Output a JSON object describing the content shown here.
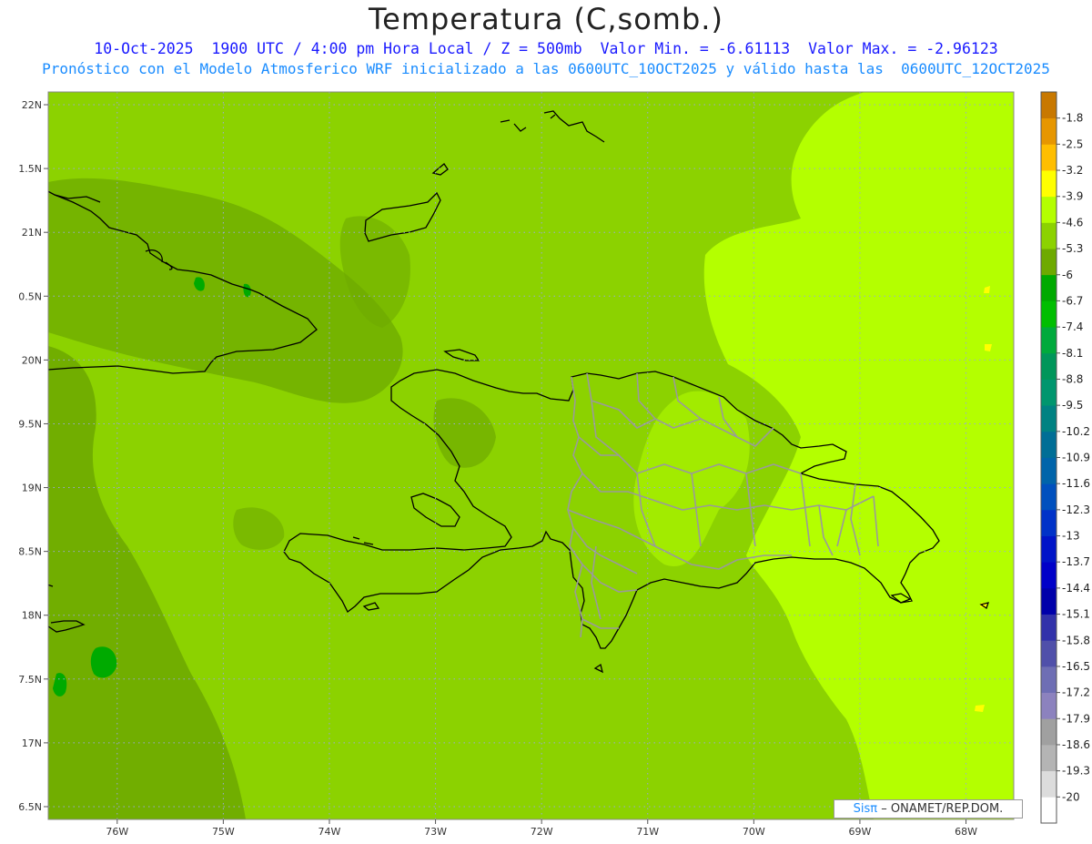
{
  "header": {
    "title": "Temperatura (C,somb.)",
    "line1": "10-Oct-2025  1900 UTC / 4:00 pm Hora Local / Z = 500mb  Valor Min. = -6.61113  Valor Max. = -2.96123",
    "line2": "Pronóstico con el Modelo Atmosferico WRF inicializado a las 0600UTC_10OCT2025 y válido hasta las  0600UTC_12OCT2025"
  },
  "map": {
    "lon_range": [
      -76.65,
      -67.55
    ],
    "lat_range": [
      16.4,
      22.1
    ],
    "lon_ticks": [
      "76W",
      "75W",
      "74W",
      "73W",
      "72W",
      "71W",
      "70W",
      "69W",
      "68W"
    ],
    "lat_ticks": [
      "22N",
      "1.5N",
      "21N",
      "0.5N",
      "20N",
      "9.5N",
      "19N",
      "8.5N",
      "18N",
      "7.5N",
      "17N",
      "6.5N"
    ],
    "grid": true
  },
  "colorbar": {
    "labels": [
      "-1.8",
      "-2.5",
      "-3.2",
      "-3.9",
      "-4.6",
      "-5.3",
      "-6",
      "-6.7",
      "-7.4",
      "-8.1",
      "-8.8",
      "-9.5",
      "-10.2",
      "-10.9",
      "-11.6",
      "-12.3",
      "-13",
      "-13.7",
      "-14.4",
      "-15.1",
      "-15.8",
      "-16.5",
      "-17.2",
      "-17.9",
      "-18.6",
      "-19.3",
      "-20"
    ],
    "colors": [
      "#c87800",
      "#e69600",
      "#ffbe00",
      "#ffff00",
      "#b4ff00",
      "#8cd200",
      "#6eaa00",
      "#00aa00",
      "#00be00",
      "#00aa3c",
      "#00965a",
      "#00966e",
      "#008282",
      "#006e96",
      "#0064aa",
      "#0050be",
      "#0032c8",
      "#0014c8",
      "#0000c8",
      "#0000aa",
      "#3232aa",
      "#5050aa",
      "#6e6eb4",
      "#8c82be",
      "#a0a0a0",
      "#b4b4b4",
      "#dcdcdc",
      "#ffffff"
    ]
  },
  "credit": {
    "logo": "Sisπ",
    "text": "– ONAMET/REP.DOM."
  }
}
